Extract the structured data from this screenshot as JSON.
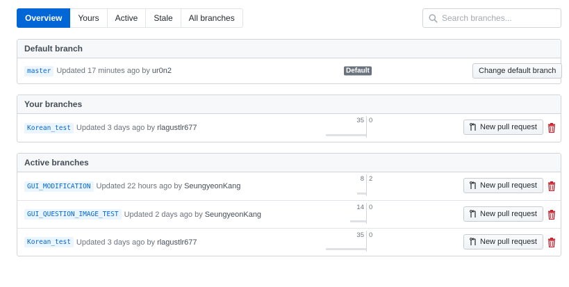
{
  "subnav": {
    "tabs": [
      {
        "label": "Overview",
        "selected": true
      },
      {
        "label": "Yours",
        "selected": false
      },
      {
        "label": "Active",
        "selected": false
      },
      {
        "label": "Stale",
        "selected": false
      },
      {
        "label": "All branches",
        "selected": false
      }
    ]
  },
  "search": {
    "placeholder": "Search branches...",
    "icon": "search-icon"
  },
  "default_section": {
    "title": "Default branch",
    "branch": {
      "name": "master",
      "updated": "Updated 17 minutes ago by",
      "author": "ur0n2"
    },
    "badge": "Default",
    "button": "Change default branch"
  },
  "your_section": {
    "title": "Your branches",
    "branches": [
      {
        "name": "Korean_test",
        "updated": "Updated 3 days ago by",
        "author": "rlagustlr677",
        "behind": "35",
        "ahead": "0",
        "behind_value": 35,
        "button": "New pull request"
      }
    ]
  },
  "active_section": {
    "title": "Active branches",
    "branches": [
      {
        "name": "GUI_MODIFICATION",
        "updated": "Updated 22 hours ago by",
        "author": "SeungyeonKang",
        "behind": "8",
        "ahead": "2",
        "behind_value": 8,
        "button": "New pull request"
      },
      {
        "name": "GUI_QUESTION_IMAGE_TEST",
        "updated": "Updated 2 days ago by",
        "author": "SeungyeonKang",
        "behind": "14",
        "ahead": "0",
        "behind_value": 14,
        "button": "New pull request"
      },
      {
        "name": "Korean_test",
        "updated": "Updated 3 days ago by",
        "author": "rlagustlr677",
        "behind": "35",
        "ahead": "0",
        "behind_value": 35,
        "button": "New pull request"
      }
    ]
  },
  "colors": {
    "accent": "#0366d6",
    "trash": "#cb2431",
    "badge": "#6a737d"
  }
}
